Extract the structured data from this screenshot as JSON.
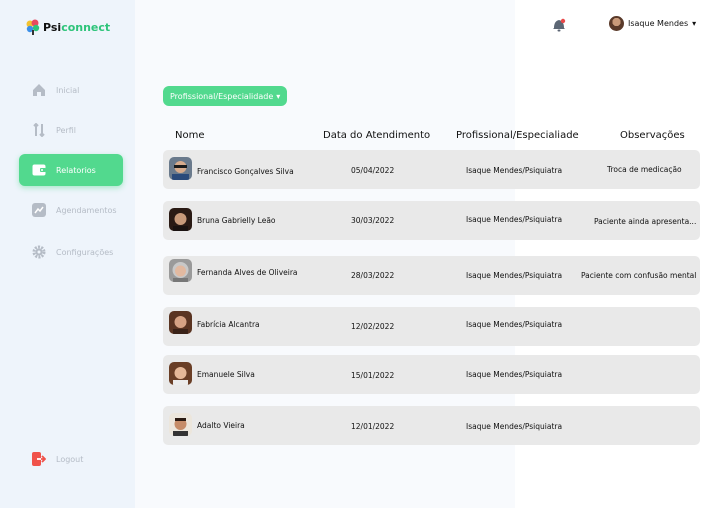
{
  "brand": {
    "part1": "Psi",
    "part2": "connect"
  },
  "nav": [
    {
      "label": "Inicial",
      "icon": "home-icon"
    },
    {
      "label": "Perfil",
      "icon": "profile-icon"
    },
    {
      "label": "Relatorios",
      "icon": "wallet-icon",
      "active": true
    },
    {
      "label": "Agendamentos",
      "icon": "chart-icon"
    },
    {
      "label": "Configurações",
      "icon": "gear-icon"
    }
  ],
  "logout_label": "Logout",
  "header": {
    "user_name": "Isaque Mendes",
    "dropdown_caret": "▾"
  },
  "filter": {
    "label": "Profissional/Especialidade",
    "caret": "▾"
  },
  "table": {
    "headers": [
      "Nome",
      "Data do Atendimento",
      "Profissional/Especialiade",
      "Observações"
    ],
    "rows": [
      {
        "name": "Francisco Gonçalves Silva",
        "date": "05/04/2022",
        "prof": "Isaque Mendes/Psiquiatra",
        "obs": "Troca de medicação"
      },
      {
        "name": "Bruna Gabrielly Leão",
        "date": "30/03/2022",
        "prof": "Isaque Mendes/Psiquiatra",
        "obs": "Paciente ainda apresenta..."
      },
      {
        "name": "Fernanda Alves de Oliveira",
        "date": "28/03/2022",
        "prof": "Isaque Mendes/Psiquiatra",
        "obs": "Paciente com confusão mental"
      },
      {
        "name": "Fabrícia Alcantra",
        "date": "12/02/2022",
        "prof": "Isaque Mendes/Psiquiatra",
        "obs": ""
      },
      {
        "name": "Emanuele Silva",
        "date": "15/01/2022",
        "prof": "Isaque Mendes/Psiquiatra",
        "obs": ""
      },
      {
        "name": "Adalto Vieira",
        "date": "12/01/2022",
        "prof": "Isaque Mendes/Psiquiatra",
        "obs": ""
      }
    ]
  },
  "colors": {
    "accent": "#52d98e",
    "sidebar": "#eef4fb",
    "row": "#e9e9e9",
    "logout": "#f0524a"
  }
}
